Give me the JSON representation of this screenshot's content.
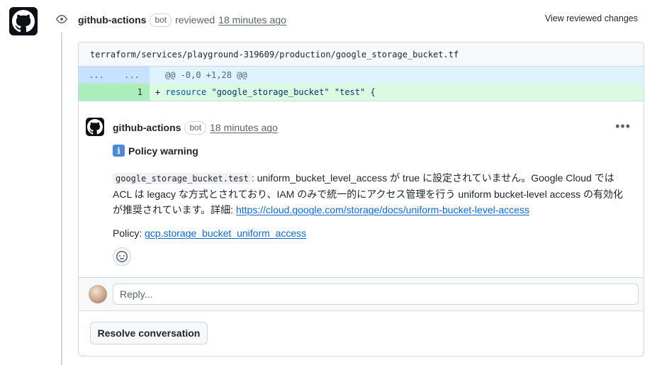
{
  "review": {
    "author": "github-actions",
    "bot_label": "bot",
    "action": "reviewed",
    "timestamp": "18 minutes ago",
    "view_changes": "View reviewed changes"
  },
  "file": {
    "path": "terraform/services/playground-319609/production/google_storage_bucket.tf"
  },
  "diff": {
    "hunk_old": "...",
    "hunk_new": "...",
    "hunk_header": "@@ -0,0 +1,28 @@",
    "line_number": "1",
    "line_prefix": "+ ",
    "line_keyword": "resource",
    "line_rest": " \"google_storage_bucket\" \"test\" {"
  },
  "comment": {
    "author": "github-actions",
    "bot_label": "bot",
    "timestamp": "18 minutes ago",
    "title": "Policy warning",
    "info_glyph": "i",
    "resource_code": "google_storage_bucket.test",
    "message": ": uniform_bucket_level_access が true に設定されていません。Google Cloud では ACL は legacy な方式とされており、IAM のみで統一的にアクセス管理を行う uniform bucket-level access の有効化が推奨されています。詳細: ",
    "doc_link": "https://cloud.google.com/storage/docs/uniform-bucket-level-access",
    "policy_label": "Policy: ",
    "policy_link": "gcp.storage_bucket_uniform_access"
  },
  "reply": {
    "placeholder": "Reply..."
  },
  "resolve": {
    "label": "Resolve conversation"
  },
  "icons": {
    "avatar": "github-octocat-icon",
    "review_badge": "eye-icon",
    "kebab": "kebab-horizontal-icon",
    "emoji": "smiley-icon",
    "info": "information-icon"
  }
}
